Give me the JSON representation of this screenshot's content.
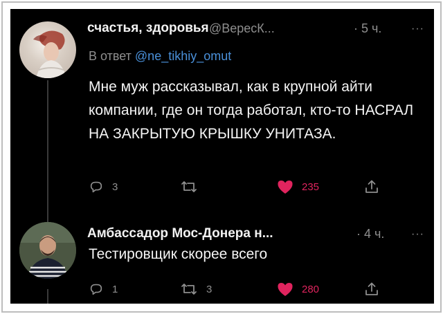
{
  "tweets": [
    {
      "author": "счастья, здоровья",
      "handle": "@ВересК...",
      "time": "· 5 ч.",
      "more": "···",
      "reply_prefix": "В ответ",
      "reply_handle": "@ne_tikhiy_omut",
      "text": "Мне муж рассказывал, как в крупной айти компании, где он тогда работал, кто-то НАСРАЛ НА ЗАКРЫТУЮ КРЫШКУ УНИТАЗА.",
      "replies": "3",
      "retweets": "",
      "likes": "235"
    },
    {
      "author": "Амбассадор Мос-Донера н...",
      "handle": "",
      "time": "· 4 ч.",
      "more": "···",
      "text": "Тестировщик скорее всего",
      "replies": "1",
      "retweets": "3",
      "likes": "280"
    }
  ],
  "colors": {
    "background": "#000000",
    "text": "#f5f5f5",
    "secondary": "#8f8f8f",
    "link": "#4a90d9",
    "like": "#e0245e"
  },
  "icons": [
    "reply-icon",
    "retweet-icon",
    "heart-filled-icon",
    "share-icon",
    "more-icon"
  ]
}
